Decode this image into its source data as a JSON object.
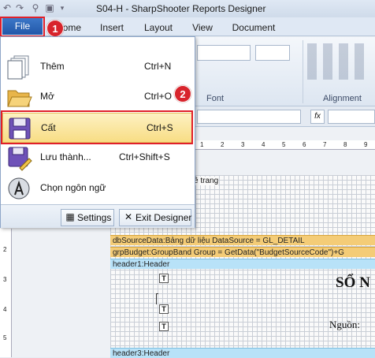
{
  "window": {
    "title": "S04-H - SharpShooter Reports Designer"
  },
  "quick_access": {
    "icons": [
      "undo-icon",
      "redo-icon",
      "print-preview-icon",
      "save-icon",
      "dropdown-icon"
    ]
  },
  "tabs": {
    "file": "File",
    "home": "Home",
    "insert": "Insert",
    "layout": "Layout",
    "view": "View",
    "document": "Document"
  },
  "ribbon": {
    "font_group": "Font",
    "alignment_group": "Alignment"
  },
  "file_menu": {
    "items": [
      {
        "label": "Thêm",
        "shortcut": "Ctrl+N",
        "icon": "new-document-icon"
      },
      {
        "label": "Mở",
        "shortcut": "Ctrl+O",
        "icon": "open-folder-icon"
      },
      {
        "label": "Cất",
        "shortcut": "Ctrl+S",
        "icon": "save-disk-icon",
        "selected": true
      },
      {
        "label": "Lưu thành...",
        "shortcut": "Ctrl+Shift+S",
        "icon": "save-as-icon"
      },
      {
        "label": "Chọn ngôn ngữ",
        "shortcut": "",
        "icon": "language-globe-icon"
      }
    ],
    "settings_label": "Settings",
    "exit_label": "Exit Designer"
  },
  "annotations": {
    "badge_1": "1",
    "badge_2": "2",
    "highlight_color": "#e0202a"
  },
  "design": {
    "ruler_top": [
      "1",
      "2",
      "3",
      "4",
      "5",
      "6",
      "7",
      "8",
      "9"
    ],
    "ruler_left": [
      "2",
      "3",
      "4",
      "5"
    ],
    "page_header_text": "ê trang",
    "bands": [
      {
        "text": "dbSourceData:Bảng dữ liệu  DataSource = GL_DETAIL",
        "type": "orange"
      },
      {
        "text": "grpBudget:GroupBand  Group = GetData(\"BudgetSourceCode\")+G",
        "type": "orange"
      },
      {
        "text": "header1:Header",
        "type": "blue"
      },
      {
        "text": "header3:Header",
        "type": "blue"
      }
    ],
    "title_text": "SỔ N",
    "source_text": "Nguồn:",
    "textbox_glyph": "T"
  },
  "colors": {
    "file_tab": "#2a63b5",
    "band_orange": "#f4cc77",
    "band_blue": "#b8e2f8",
    "menu_selected": "#f8dd84"
  }
}
